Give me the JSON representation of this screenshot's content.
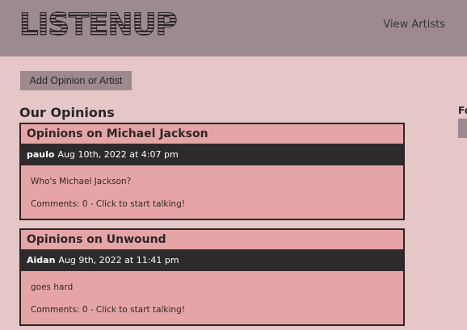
{
  "header": {
    "logo": "LISTENUP",
    "nav_link": "View Artists"
  },
  "actions": {
    "add_button": "Add Opinion or Artist"
  },
  "main": {
    "section_title": "Our Opinions",
    "side_label": "Fo"
  },
  "opinions": [
    {
      "title": "Opinions on Michael Jackson",
      "author": "paulo",
      "date": "Aug 10th, 2022 at 4:07 pm",
      "text": "Who's Michael Jackson?",
      "comments": "Comments: 0 - Click to start talking!"
    },
    {
      "title": "Opinions on Unwound",
      "author": "Aidan",
      "date": "Aug 9th, 2022 at 11:41 pm",
      "text": "goes hard",
      "comments": "Comments: 0 - Click to start talking!"
    }
  ]
}
